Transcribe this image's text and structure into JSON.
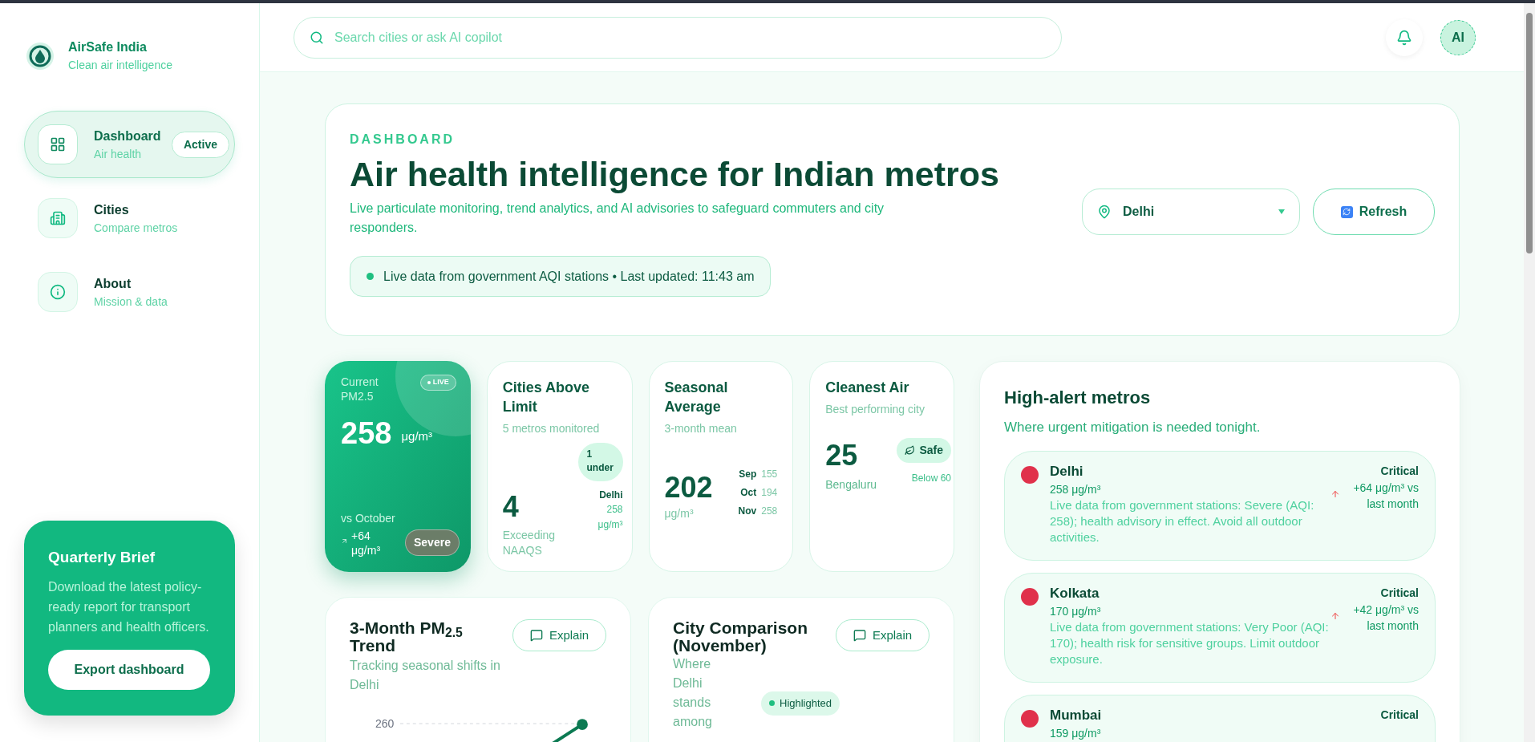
{
  "brand": {
    "name": "AirSafe India",
    "tagline": "Clean air intelligence"
  },
  "nav": [
    {
      "label": "Dashboard",
      "sub": "Air health",
      "selected": true,
      "badge": "Active"
    },
    {
      "label": "Cities",
      "sub": "Compare metros",
      "selected": false
    },
    {
      "label": "About",
      "sub": "Mission & data",
      "selected": false
    }
  ],
  "promo": {
    "title": "Quarterly Brief",
    "text": "Download the latest policy-ready report for transport planners and health officers.",
    "button": "Export dashboard"
  },
  "header": {
    "search_placeholder": "Search cities or ask AI copilot",
    "avatar": "AI"
  },
  "hero": {
    "eyebrow": "DASHBOARD",
    "title": "Air health intelligence for Indian metros",
    "subtitle": "Live particulate monitoring, trend analytics, and AI advisories to safeguard commuters and city responders.",
    "status": "Live data from government AQI stations • Last updated: 11:43 am",
    "city_select": "Delhi",
    "refresh": "Refresh"
  },
  "current": {
    "label": "Current PM2.5",
    "badge": "LIVE",
    "value": "258",
    "unit": "μg/m³",
    "compare": "vs October",
    "change": "+64 μg/m³",
    "severity": "Severe"
  },
  "cities_above": {
    "title": "Cities Above Limit",
    "sub": "5 metros monitored",
    "value": "4",
    "caption": "Exceeding NAAQS",
    "pill": "1 under",
    "city": "Delhi",
    "city_value": "258 μg/m³"
  },
  "seasonal": {
    "title": "Seasonal Average",
    "sub": "3-month mean",
    "value": "202",
    "unit": "μg/m³",
    "months": [
      {
        "month": "Sep",
        "value": "155"
      },
      {
        "month": "Oct",
        "value": "194"
      },
      {
        "month": "Nov",
        "value": "258"
      }
    ]
  },
  "cleanest": {
    "title": "Cleanest Air",
    "sub": "Best performing city",
    "value": "25",
    "city": "Bengaluru",
    "badge": "Safe",
    "note": "Below 60"
  },
  "alerts": {
    "title": "High-alert metros",
    "subtitle": "Where urgent mitigation is needed tonight.",
    "items": [
      {
        "city": "Delhi",
        "value": "258 μg/m³",
        "text": "Live data from government stations: Severe (AQI: 258); health advisory in effect. Avoid all outdoor activities.",
        "level": "Critical",
        "change": "+64 μg/m³ vs last month",
        "color": "#e0314b"
      },
      {
        "city": "Kolkata",
        "value": "170 μg/m³",
        "text": "Live data from government stations: Very Poor (AQI: 170); health risk for sensitive groups. Limit outdoor exposure.",
        "level": "Critical",
        "change": "+42 μg/m³ vs last month",
        "color": "#e0314b"
      },
      {
        "city": "Mumbai",
        "value": "159 μg/m³",
        "level": "Critical",
        "color": "#e0314b"
      }
    ]
  },
  "trend": {
    "title": "3-Month PM$_{2.5}$ Trend",
    "sub": "Tracking seasonal shifts in Delhi",
    "button": "Explain",
    "tick": "260"
  },
  "comparison": {
    "title": "City Comparison (November)",
    "sub": "Where Delhi stands among",
    "button": "Explain",
    "legend": "Highlighted"
  }
}
